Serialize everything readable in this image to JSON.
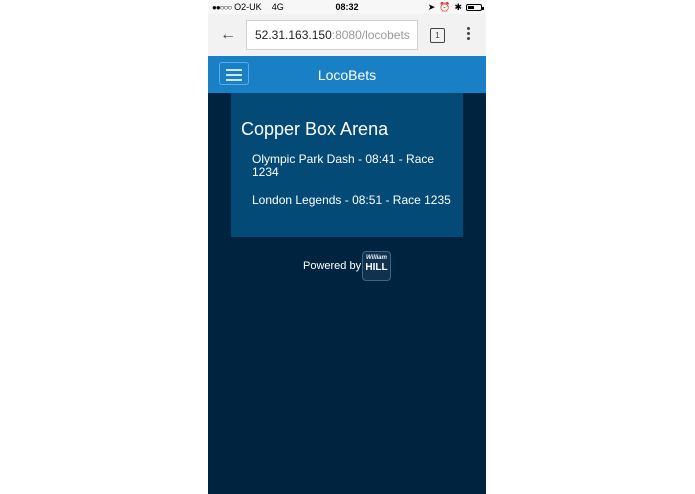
{
  "status_bar": {
    "carrier": "O2-UK",
    "network": "4G",
    "time": "08:32"
  },
  "browser": {
    "url_main": "52.31.163.150",
    "url_dim": ":8080/locobets",
    "tab_count": "1"
  },
  "header": {
    "title": "LocoBets"
  },
  "venue": {
    "title": "Copper Box Arena",
    "races": [
      {
        "label": "Olympic Park Dash - 08:41 - Race 1234"
      },
      {
        "label": "London Legends - 08:51 - Race 1235"
      }
    ]
  },
  "footer": {
    "powered_by": "Powered by",
    "logo_script": "William",
    "logo_text": "HILL"
  },
  "colors": {
    "header_bg": "#1a80c6",
    "page_bg": "#002440",
    "card_bg": "#034a77"
  }
}
